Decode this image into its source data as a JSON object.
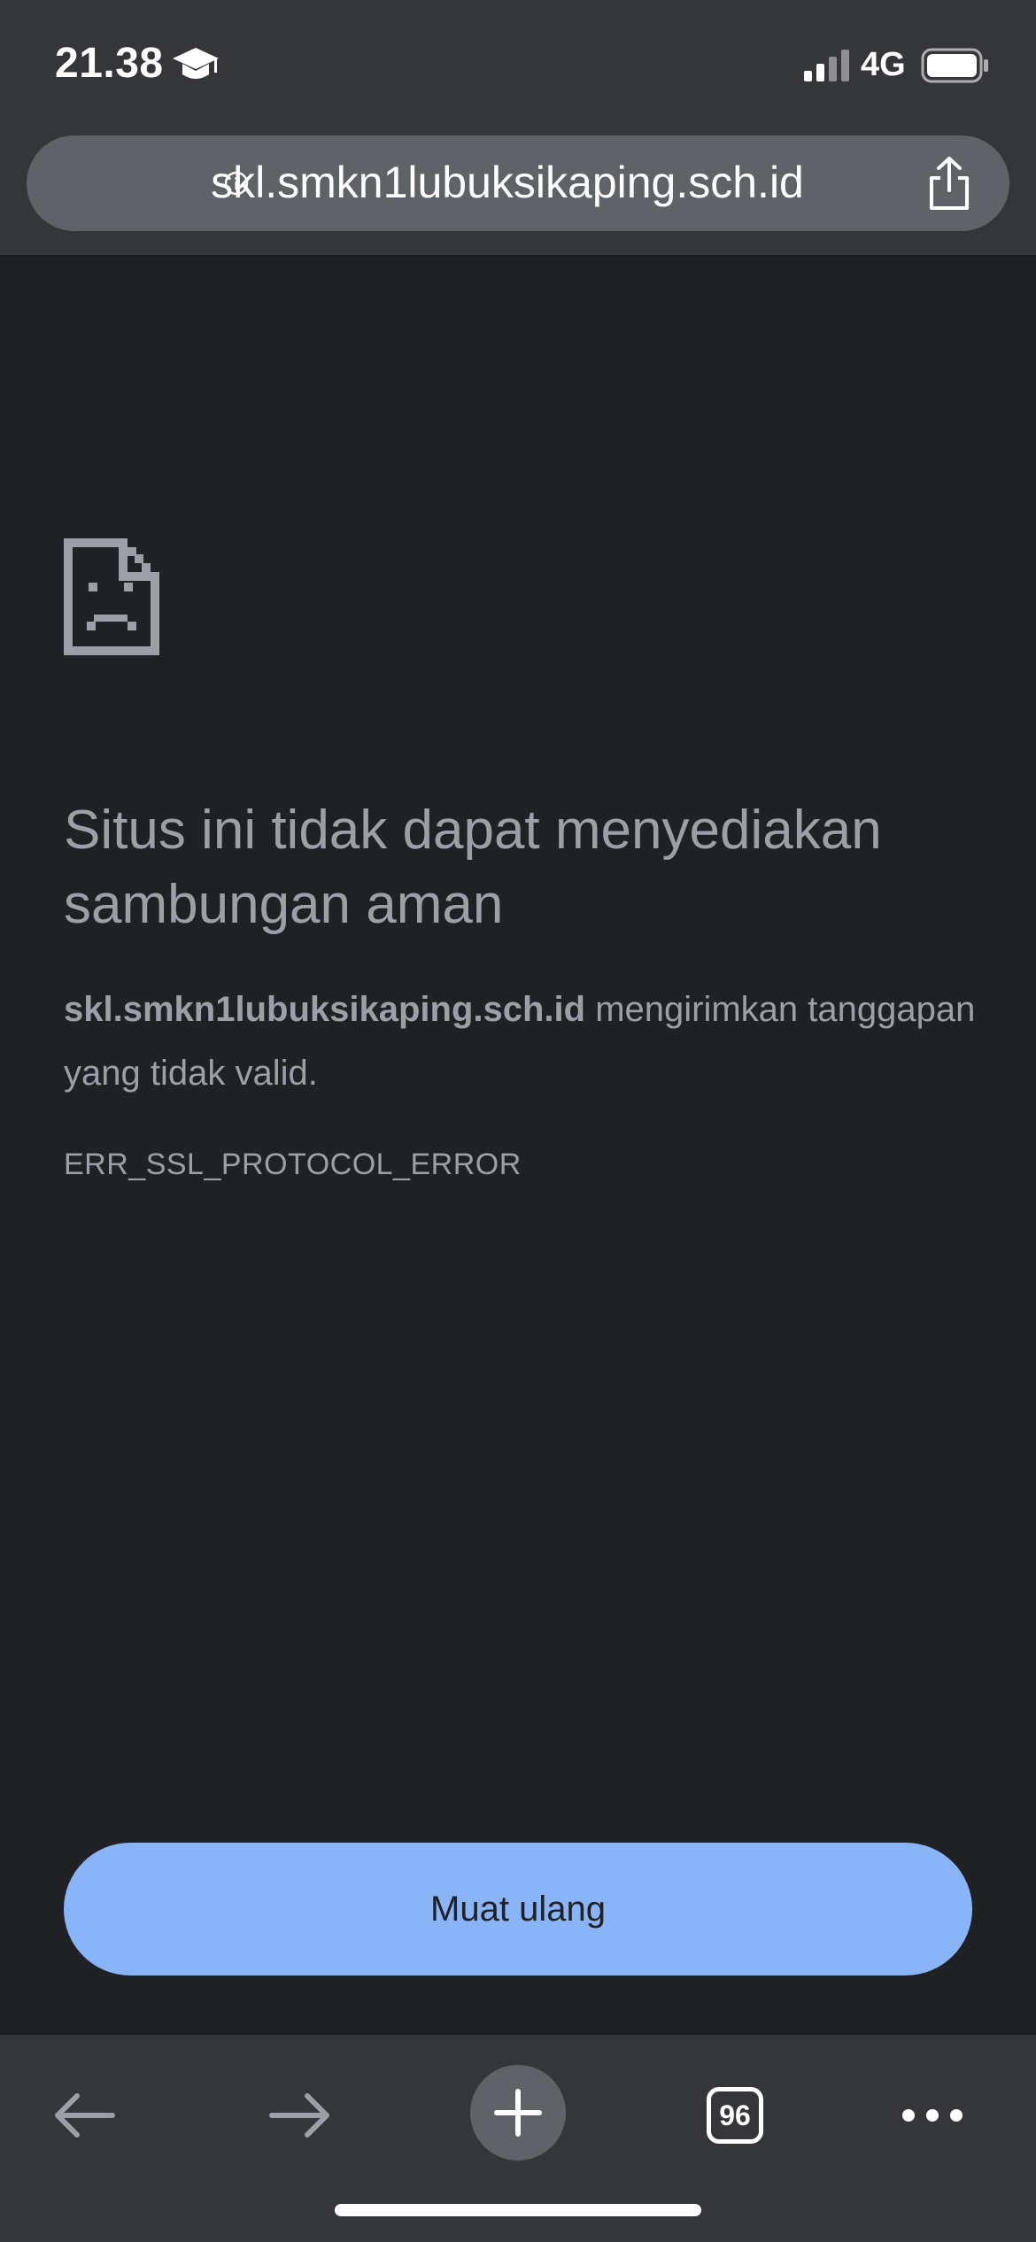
{
  "status_bar": {
    "time": "21.38",
    "network": "4G"
  },
  "browser": {
    "url": "skl.smkn1lubuksikaping.sch.id",
    "tab_count": "96"
  },
  "error_page": {
    "title": "Situs ini tidak dapat menyediakan sambungan aman",
    "host": "skl.smkn1lubuksikaping.sch.id",
    "description_suffix": " mengirimkan tanggapan yang tidak valid.",
    "error_code": "ERR_SSL_PROTOCOL_ERROR",
    "reload_label": "Muat ulang"
  },
  "icons": [
    "graduation-cap-icon",
    "signal-icon",
    "battery-icon",
    "info-icon",
    "share-icon",
    "sad-document-icon",
    "back-arrow-icon",
    "forward-arrow-icon",
    "plus-icon",
    "more-icon"
  ],
  "colors": {
    "page_bg": "#202124",
    "chrome_bg": "#35363a",
    "url_bar_bg": "#5f6368",
    "text_muted": "#9aa0a6",
    "button_bg": "#8ab4f8"
  }
}
